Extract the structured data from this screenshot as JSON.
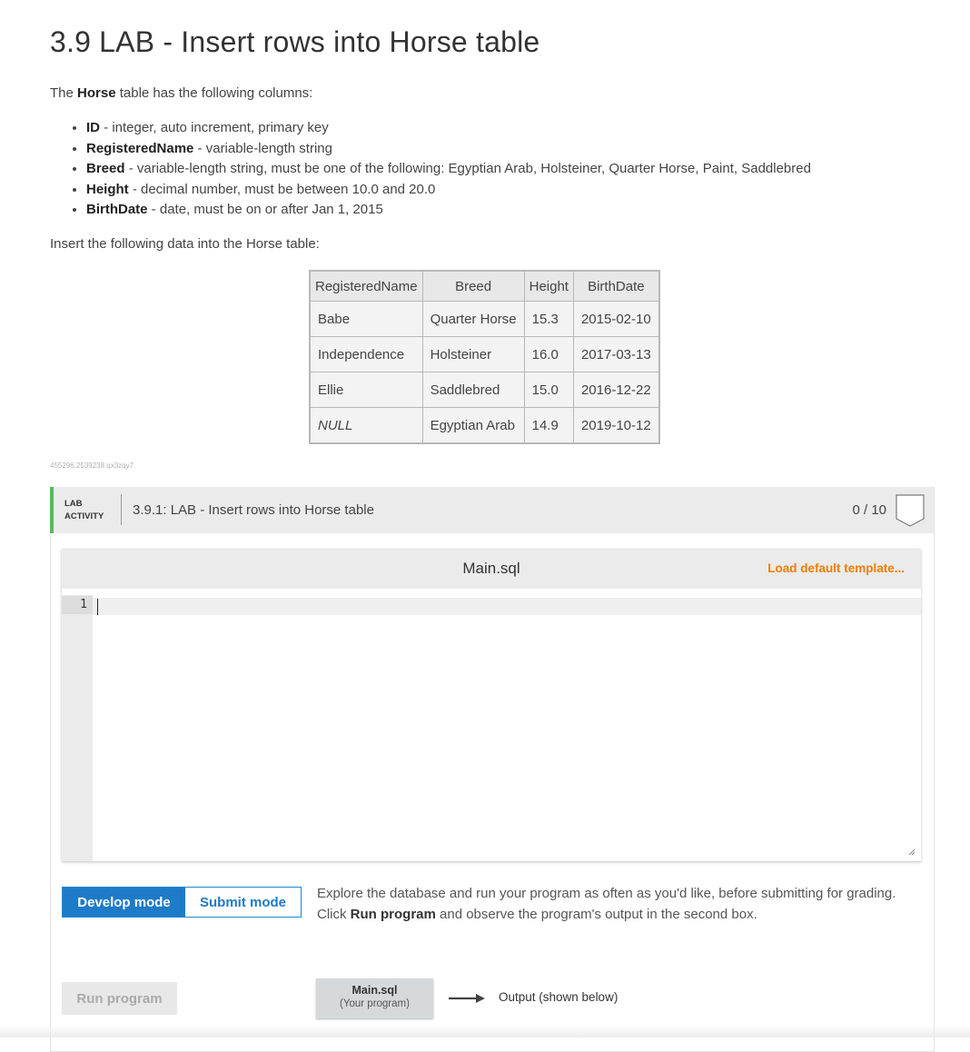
{
  "page": {
    "title": "3.9 LAB - Insert rows into Horse table",
    "intro_pre": "The ",
    "intro_bold": "Horse",
    "intro_post": " table has the following columns:",
    "columns": [
      {
        "name": "ID",
        "desc": " - integer, auto increment, primary key"
      },
      {
        "name": "RegisteredName",
        "desc": " - variable-length string"
      },
      {
        "name": "Breed",
        "desc": " - variable-length string, must be one of the following: Egyptian Arab, Holsteiner, Quarter Horse, Paint, Saddlebred"
      },
      {
        "name": "Height",
        "desc": " - decimal number, must be between 10.0 and 20.0"
      },
      {
        "name": "BirthDate",
        "desc": " - date, must be on or after Jan 1, 2015"
      }
    ],
    "insert_text": "Insert the following data into the Horse table:",
    "small_id": "455296.2539238.qx3zqy7"
  },
  "data_table": {
    "headers": [
      "RegisteredName",
      "Breed",
      "Height",
      "BirthDate"
    ],
    "rows": [
      [
        "Babe",
        "Quarter Horse",
        "15.3",
        "2015-02-10"
      ],
      [
        "Independence",
        "Holsteiner",
        "16.0",
        "2017-03-13"
      ],
      [
        "Ellie",
        "Saddlebred",
        "15.0",
        "2016-12-22"
      ],
      [
        "NULL",
        "Egyptian Arab",
        "14.9",
        "2019-10-12"
      ]
    ]
  },
  "lab": {
    "label_line1": "LAB",
    "label_line2": "ACTIVITY",
    "name": "3.9.1: LAB - Insert rows into Horse table",
    "score": "0 / 10",
    "accent_color": "#5cb85c"
  },
  "editor": {
    "filename": "Main.sql",
    "load_template_label": "Load default template...",
    "line_number": "1"
  },
  "modes": {
    "develop_label": "Develop mode",
    "submit_label": "Submit mode",
    "active": "Develop mode"
  },
  "explain": {
    "part1": "Explore the database and run your program as often as you'd like, before submitting for grading. Click ",
    "bold": "Run program",
    "part2": " and observe the program's output in the second box."
  },
  "run": {
    "button_label": "Run program",
    "file_name": "Main.sql",
    "file_sub": "(Your program)",
    "output_label": "Output (shown below)"
  },
  "colors": {
    "primary": "#1e7bc8",
    "link_orange": "#f07c00",
    "lab_green": "#5cb85c"
  }
}
